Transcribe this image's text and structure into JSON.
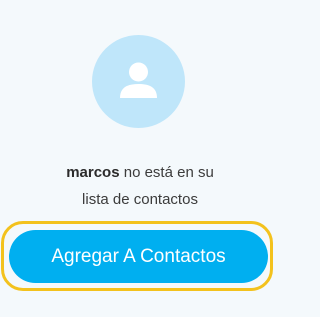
{
  "contact": {
    "name": "marcos",
    "message_rest": " no está en su",
    "message_line2": "lista de contactos",
    "avatar_icon": "person-icon"
  },
  "actions": {
    "add_button_label": "Agregar A Contactos"
  },
  "colors": {
    "background": "#f4f9fc",
    "avatar_bg": "#bfe6fa",
    "button_bg": "#00aff0",
    "highlight": "#f3c21d"
  }
}
